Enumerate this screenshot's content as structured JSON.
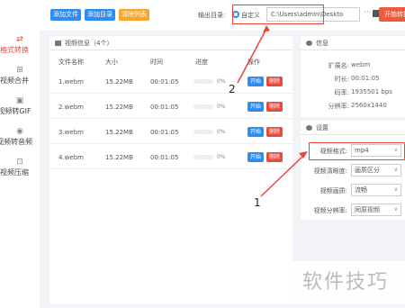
{
  "sidebar": {
    "items": [
      {
        "label": "格式转换",
        "icon": "convert-icon"
      },
      {
        "label": "视频合并",
        "icon": "merge-icon"
      },
      {
        "label": "视频转GIF",
        "icon": "gif-icon"
      },
      {
        "label": "视频转音频",
        "icon": "audio-icon"
      },
      {
        "label": "视频压缩",
        "icon": "compress-icon"
      }
    ]
  },
  "toolbar": {
    "add_file": "添加文件",
    "add_dir": "添加目录",
    "clear_list": "清除列表",
    "output_label": "输出目录:",
    "radio_label": "自定义",
    "path_value": "C:\\Users\\admin\\Deskto",
    "dots": "···",
    "start_all": "开始转换"
  },
  "list": {
    "title": "视频信息（4个）",
    "headers": [
      "文件名称",
      "大小",
      "时间",
      "进度",
      "操作"
    ],
    "rows": [
      {
        "name": "1.webm",
        "size": "15.22MB",
        "time": "00:01:05",
        "progress": "0%",
        "start": "开始",
        "delete": "删除"
      },
      {
        "name": "2.webm",
        "size": "15.22MB",
        "time": "00:01:05",
        "progress": "0%",
        "start": "开始",
        "delete": "删除"
      },
      {
        "name": "3.webm",
        "size": "15.22MB",
        "time": "00:01:05",
        "progress": "0%",
        "start": "开始",
        "delete": "删除"
      },
      {
        "name": "4.webm",
        "size": "15.22MB",
        "time": "00:01:05",
        "progress": "0%",
        "start": "开始",
        "delete": "删除"
      }
    ]
  },
  "info": {
    "title": "信息",
    "fields": [
      {
        "label": "扩展名:",
        "value": "webm"
      },
      {
        "label": "时长:",
        "value": "00:01:05"
      },
      {
        "label": "码率:",
        "value": "1935501 bps"
      },
      {
        "label": "分辨率:",
        "value": "2560x1440"
      }
    ]
  },
  "settings": {
    "title": "设置",
    "fields": [
      {
        "label": "视频格式:",
        "value": "mp4"
      },
      {
        "label": "视频清晰度:",
        "value": "画质区分"
      },
      {
        "label": "视频画质:",
        "value": "流畅"
      },
      {
        "label": "视频分辨率:",
        "value": "同原视频"
      }
    ]
  },
  "annotations": {
    "num1": "1",
    "num2": "2"
  },
  "watermark": "软件技巧",
  "colors": {
    "accent": "#2d8cf0",
    "orange": "#f7a52b",
    "red": "#e84a3c",
    "start_btn": "#2d8cf0",
    "delete_btn": "#e84a3c"
  }
}
